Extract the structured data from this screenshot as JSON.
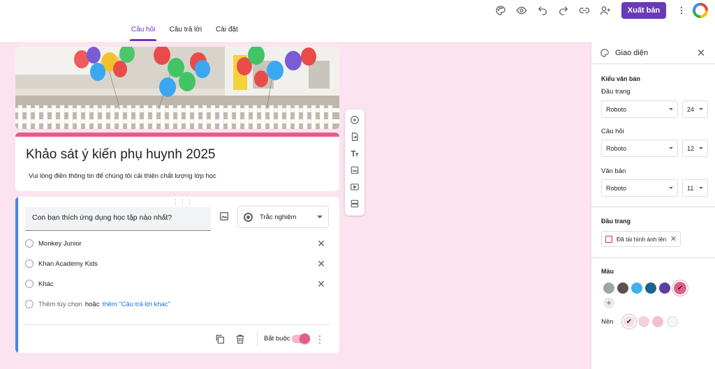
{
  "toolbar": {
    "publish_label": "Xuất bản",
    "icons": [
      "palette-icon",
      "preview-eye-icon",
      "undo-icon",
      "redo-icon",
      "link-icon",
      "add-collaborator-icon",
      "more-vert-icon"
    ]
  },
  "tabs": [
    {
      "label": "Câu hỏi",
      "active": true
    },
    {
      "label": "Câu trả lời",
      "active": false
    },
    {
      "label": "Cài đặt",
      "active": false
    }
  ],
  "form": {
    "title": "Khảo sát ý kiến phụ huynh 2025",
    "description": "Vui lòng điền thông tin để chúng tôi cải thiện chất lượng lớp học"
  },
  "question": {
    "text": "Con bạn thích ứng dụng học tập nào nhất?",
    "type": "Trắc nghiệm",
    "options": [
      "Monkey Junior",
      "Khan Academy Kids",
      "Khác"
    ],
    "add_option": "Thêm tùy chọn",
    "or": "hoặc",
    "add_other": "thêm \"Câu trả lời khác\"",
    "required_label": "Bắt buộc",
    "required": true
  },
  "panel": {
    "title": "Giao diện",
    "text_style_label": "Kiểu văn bản",
    "header_label": "Đầu trang",
    "header_font": "Roboto",
    "header_size": "24",
    "question_label": "Câu hỏi",
    "question_font": "Roboto",
    "question_size": "12",
    "text_label": "Văn bản",
    "text_font": "Roboto",
    "text_size": "11",
    "header_section_label": "Đầu trang",
    "uploaded_chip": "Đã tải hình ảnh lên",
    "color_label": "Màu",
    "background_label": "Nền"
  },
  "colors": {
    "accent": "#673ab7",
    "theme": "#e45c8b",
    "page_bg": "#fbe4ef",
    "theme_swatches": [
      "#9aa8a2",
      "#55524f",
      "#3fb1f0",
      "#20638a",
      "#5c3f9e",
      "#e45c8b"
    ],
    "bg_swatches": [
      "#f7dbe6",
      "#f5cfdd",
      "#f3c0d3",
      "#f6f6f6"
    ]
  }
}
